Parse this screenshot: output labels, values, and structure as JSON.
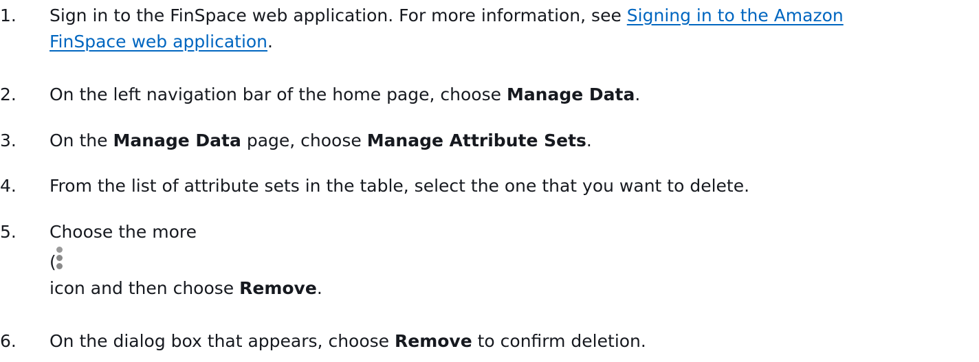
{
  "steps": [
    {
      "number": "1.",
      "text_before_link": "Sign in to the FinSpace web application. For more information, see ",
      "link_part1": "Signing in to the Amazon",
      "link_part2": "FinSpace web application",
      "text_after_link": "."
    },
    {
      "number": "2.",
      "text": "On the left navigation bar of the home page, choose ",
      "bold": "Manage Data",
      "text_after": "."
    },
    {
      "number": "3.",
      "text": "On the ",
      "bold1": "Manage Data",
      "text_mid": " page, choose ",
      "bold2": "Manage Attribute Sets",
      "text_after": "."
    },
    {
      "number": "4.",
      "text": "From the list of attribute sets in the table, select the one that you want to delete."
    },
    {
      "number": "5.",
      "text_line1": "Choose the more",
      "paren": "(",
      "icon": "more-vertical-icon",
      "text_line3": "icon and then choose ",
      "bold": "Remove",
      "text_after": "."
    },
    {
      "number": "6.",
      "text": "On the dialog box that appears, choose ",
      "bold": "Remove",
      "text_after": " to confirm deletion."
    }
  ],
  "colors": {
    "text": "#16191f",
    "link": "#0066c0",
    "icon": "#9a9a9a"
  }
}
